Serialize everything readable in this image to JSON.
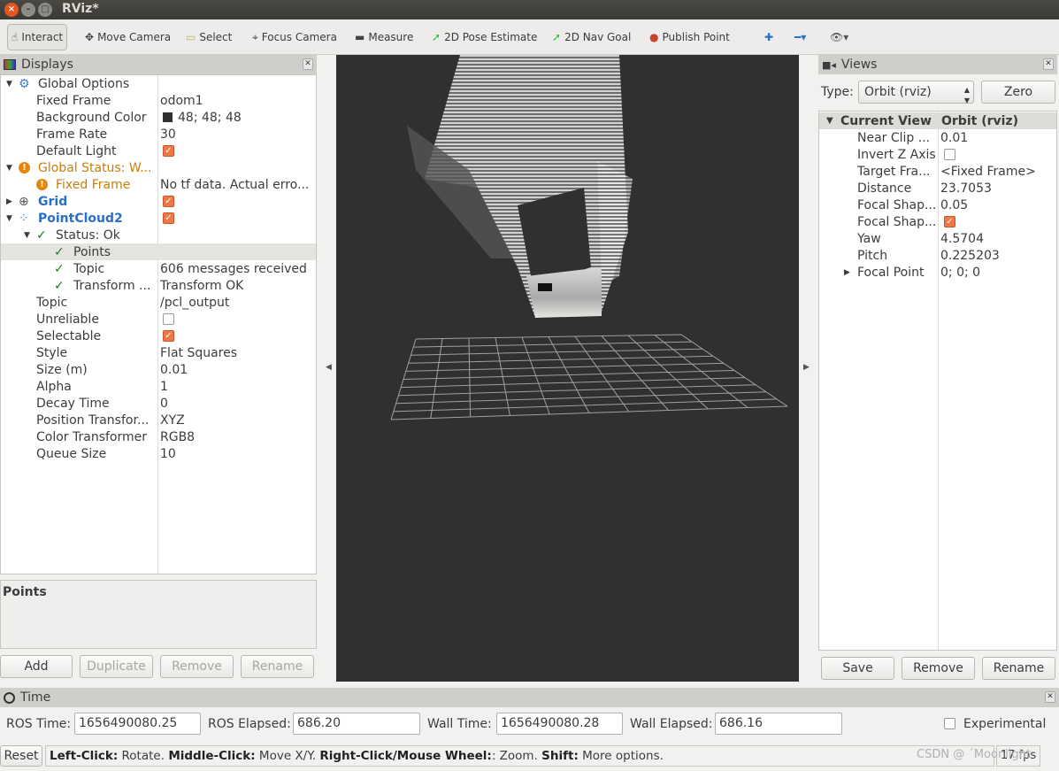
{
  "window": {
    "title": "RViz*"
  },
  "toolbar": {
    "tools": [
      {
        "label": "Interact",
        "icon": "hand-pointer-icon",
        "active": true
      },
      {
        "label": "Move Camera",
        "icon": "move-arrows-icon"
      },
      {
        "label": "Select",
        "icon": "select-box-icon"
      },
      {
        "label": "Focus Camera",
        "icon": "crosshair-icon"
      },
      {
        "label": "Measure",
        "icon": "ruler-icon"
      },
      {
        "label": "2D Pose Estimate",
        "icon": "green-arrow-icon"
      },
      {
        "label": "2D Nav Goal",
        "icon": "green-arrow-icon"
      },
      {
        "label": "Publish Point",
        "icon": "map-pin-icon"
      }
    ]
  },
  "displays": {
    "title": "Displays",
    "rows": [
      {
        "k": "Global Options",
        "v": "",
        "indent": 0,
        "expander": "▼",
        "icon": "gear-icon"
      },
      {
        "k": "Fixed Frame",
        "v": "odom1",
        "indent": 1
      },
      {
        "k": "Background Color",
        "v": "48; 48; 48",
        "indent": 1,
        "swatch": "#303030"
      },
      {
        "k": "Frame Rate",
        "v": "30",
        "indent": 1
      },
      {
        "k": "Default Light",
        "v": "",
        "indent": 1,
        "check": true
      },
      {
        "k": "Global Status: W...",
        "v": "",
        "indent": 0,
        "expander": "▼",
        "icon": "warning-icon",
        "color": "#c87f0a"
      },
      {
        "k": "Fixed Frame",
        "v": "No tf data.  Actual erro...",
        "indent": 1,
        "icon": "warning-icon",
        "color": "#c87f0a"
      },
      {
        "k": "Grid",
        "v": "",
        "indent": 0,
        "expander": "▶",
        "icon": "grid-icon",
        "check": true,
        "color": "#2a6fc9",
        "bold": true
      },
      {
        "k": "PointCloud2",
        "v": "",
        "indent": 0,
        "expander": "▼",
        "icon": "pointcloud-icon",
        "check": true,
        "color": "#2a6fc9",
        "bold": true
      },
      {
        "k": "Status: Ok",
        "v": "",
        "indent": 1,
        "expander": "▼",
        "icon": "checkmark-icon"
      },
      {
        "k": "Points",
        "v": "",
        "indent": 2,
        "icon": "checkmark-icon",
        "selected": true
      },
      {
        "k": "Topic",
        "v": "606 messages received",
        "indent": 2,
        "icon": "checkmark-icon"
      },
      {
        "k": "Transform ...",
        "v": "Transform OK",
        "indent": 2,
        "icon": "checkmark-icon"
      },
      {
        "k": "Topic",
        "v": "/pcl_output",
        "indent": 1
      },
      {
        "k": "Unreliable",
        "v": "",
        "indent": 1,
        "check": false
      },
      {
        "k": "Selectable",
        "v": "",
        "indent": 1,
        "check": true
      },
      {
        "k": "Style",
        "v": "Flat Squares",
        "indent": 1
      },
      {
        "k": "Size (m)",
        "v": "0.01",
        "indent": 1
      },
      {
        "k": "Alpha",
        "v": "1",
        "indent": 1
      },
      {
        "k": "Decay Time",
        "v": "0",
        "indent": 1
      },
      {
        "k": "Position Transfor...",
        "v": "XYZ",
        "indent": 1
      },
      {
        "k": "Color Transformer",
        "v": "RGB8",
        "indent": 1
      },
      {
        "k": "Queue Size",
        "v": "10",
        "indent": 1
      }
    ],
    "description_title": "Points",
    "buttons": {
      "add": "Add",
      "duplicate": "Duplicate",
      "remove": "Remove",
      "rename": "Rename"
    }
  },
  "views": {
    "title": "Views",
    "type_label": "Type:",
    "type_value": "Orbit (rviz)",
    "zero": "Zero",
    "header": {
      "k": "Current View",
      "v": "Orbit (rviz)"
    },
    "rows": [
      {
        "k": "Near Clip ...",
        "v": "0.01"
      },
      {
        "k": "Invert Z Axis",
        "v": "",
        "check": false
      },
      {
        "k": "Target Fra...",
        "v": "<Fixed Frame>"
      },
      {
        "k": "Distance",
        "v": "23.7053"
      },
      {
        "k": "Focal Shap...",
        "v": "0.05"
      },
      {
        "k": "Focal Shap...",
        "v": "",
        "check": true
      },
      {
        "k": "Yaw",
        "v": "4.5704"
      },
      {
        "k": "Pitch",
        "v": "0.225203"
      },
      {
        "k": "Focal Point",
        "v": "0; 0; 0",
        "expander": "▶"
      }
    ],
    "buttons": {
      "save": "Save",
      "remove": "Remove",
      "rename": "Rename"
    }
  },
  "time": {
    "title": "Time",
    "ros_time_label": "ROS Time:",
    "ros_time": "1656490080.25",
    "ros_elapsed_label": "ROS Elapsed:",
    "ros_elapsed": "686.20",
    "wall_time_label": "Wall Time:",
    "wall_time": "1656490080.28",
    "wall_elapsed_label": "Wall Elapsed:",
    "wall_elapsed": "686.16",
    "experimental": "Experimental"
  },
  "status": {
    "reset": "Reset",
    "hint": [
      {
        "b": "Left-Click:",
        "t": " Rotate. "
      },
      {
        "b": "Middle-Click:",
        "t": " Move X/Y. "
      },
      {
        "b": "Right-Click/Mouse Wheel:",
        "t": ": Zoom. "
      },
      {
        "b": "Shift:",
        "t": " More options."
      }
    ],
    "fps": "17 fps",
    "watermark": "CSDN @ ˊMoonlight"
  },
  "colors": {
    "background": "#303030",
    "accent": "#f07746",
    "link": "#2a6fc9",
    "warning": "#c87f0a"
  }
}
